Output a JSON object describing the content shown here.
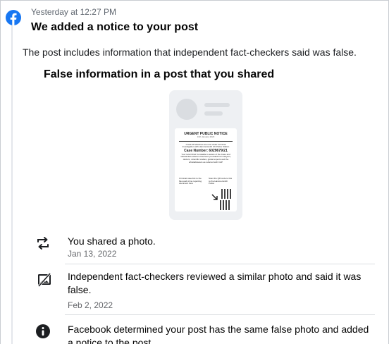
{
  "notification": {
    "timestamp": "Yesterday at 12:27 PM",
    "heading": "We added a notice to your post",
    "description": "The post includes information that independent fact-checkers said was false."
  },
  "post": {
    "subheading": "False information in a post that you shared",
    "notice_image": {
      "title": "URGENT PUBLIC NOTICE",
      "date": "11th January 2022",
      "body": "Covid-19 Vaccines are now under Criminal Investigation with Hammersmith UK Police Station",
      "case_number": "Case Number: 6029679/21",
      "detail": "Your local Chief Constable is aware of the Case and substantial evidence has been provided from lawyers, doctors, scientific studies, global experts and the whistleblowers as referred with CAP",
      "bottom_left": "Criminal case link to the files and crime reporting document here",
      "bottom_right": "Scan the QR code to link to the Hammersmith Police"
    }
  },
  "timeline": [
    {
      "icon": "share-icon",
      "title": "You shared a photo.",
      "date": "Jan 13, 2022"
    },
    {
      "icon": "fact-check-icon",
      "title": "Independent fact-checkers reviewed a similar photo and said it was false.",
      "date": "Feb 2, 2022"
    },
    {
      "icon": "info-icon",
      "title": "Facebook determined your post has the same false photo and added a notice to the post.",
      "date": ""
    }
  ],
  "colors": {
    "facebook_blue": "#1877f2",
    "text_primary": "#050505",
    "text_secondary": "#65676b",
    "separator": "#dadde1"
  }
}
